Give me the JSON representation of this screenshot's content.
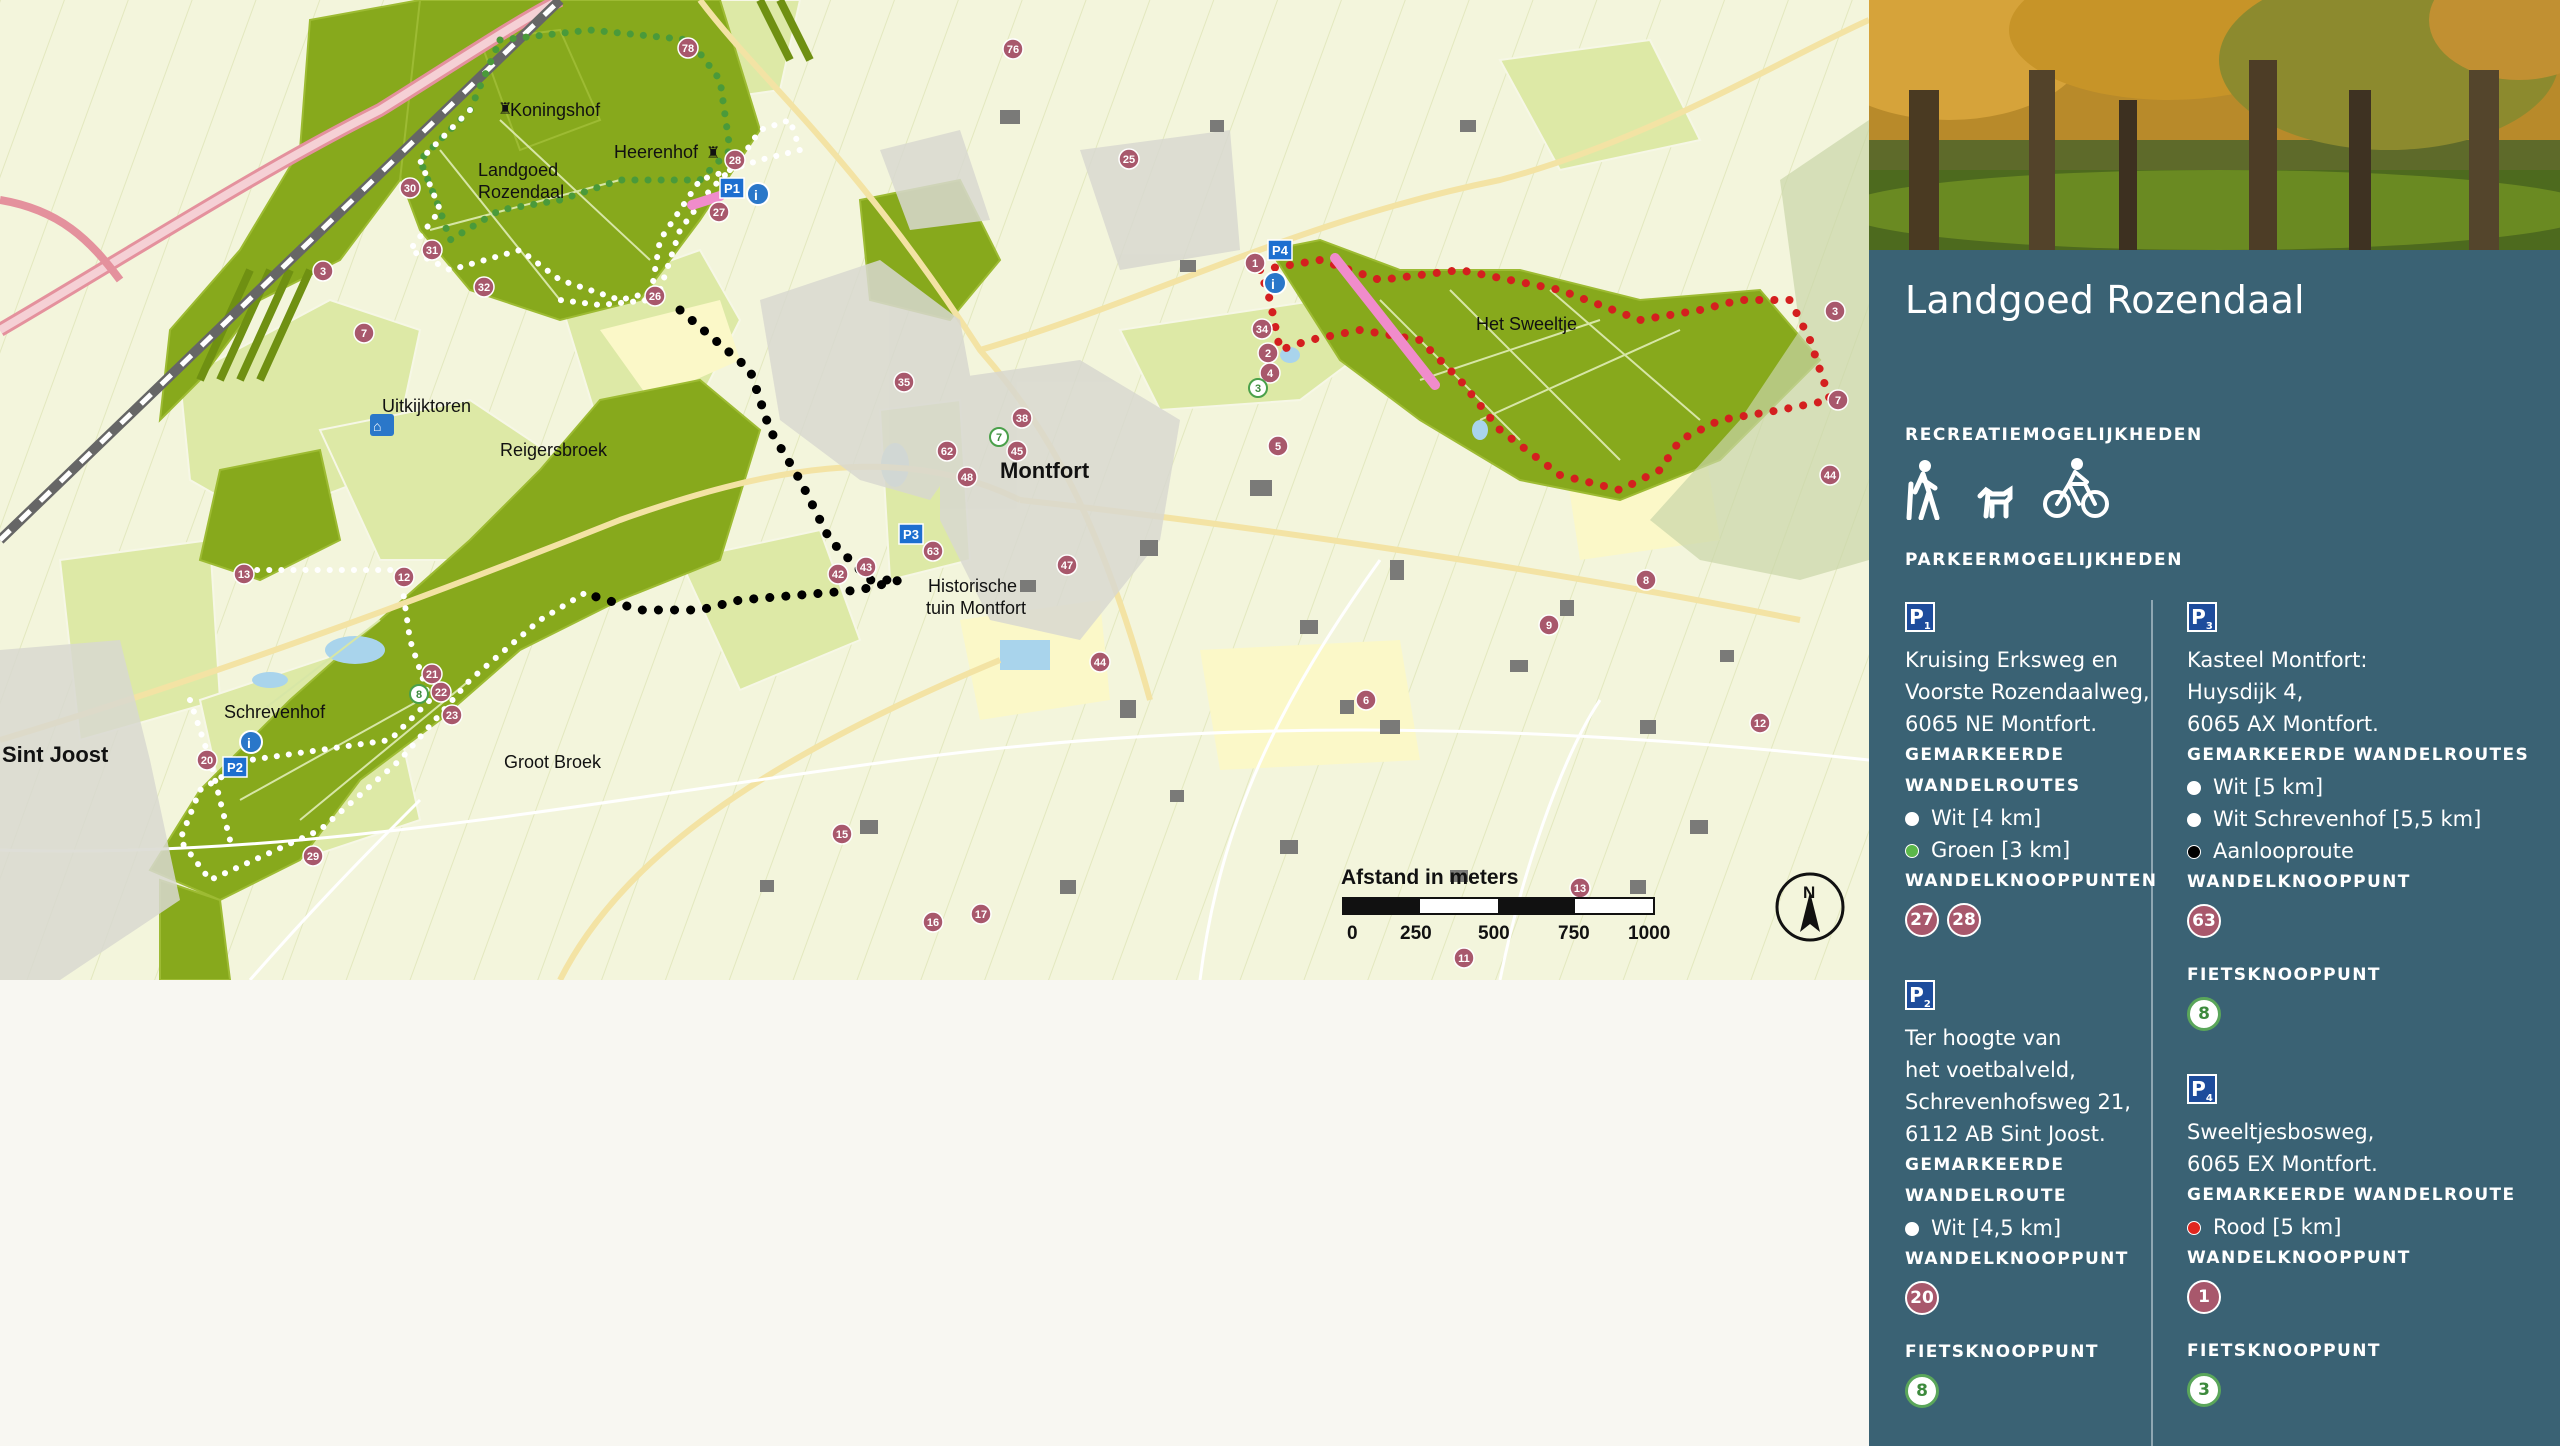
{
  "map": {
    "place_labels": {
      "koningshof": "Koningshof",
      "landgoed_rozendaal": [
        "Landgoed",
        "Rozendaal"
      ],
      "heerenhof": "Heerenhof",
      "uitkijktoren": "Uitkijktoren",
      "reigersbroek": "Reigersbroek",
      "montfort": "Montfort",
      "historische_tuin": [
        "Historische",
        "tuin Montfort"
      ],
      "het_sweeltje": "Het Sweeltje",
      "schrevenhof": "Schrevenhof",
      "sint_joost": "Sint Joost",
      "groot_broek": "Groot Broek"
    },
    "parking_labels": [
      "P1",
      "P2",
      "P3",
      "P4"
    ],
    "knooppunten": [
      "78",
      "30",
      "31",
      "32",
      "3",
      "7",
      "28",
      "27",
      "26",
      "25",
      "76",
      "35",
      "38",
      "45",
      "48",
      "62",
      "63",
      "42",
      "43",
      "47",
      "44",
      "34",
      "1",
      "2",
      "4",
      "5",
      "3",
      "7",
      "44",
      "8",
      "9",
      "6",
      "12",
      "13",
      "12",
      "21",
      "22",
      "23",
      "20",
      "29",
      "15",
      "16",
      "17",
      "11",
      "13",
      "44"
    ],
    "fiets_knooppunten": [
      "8",
      "7",
      "3"
    ],
    "scale": {
      "title": "Afstand in meters",
      "ticks": [
        "0",
        "250",
        "500",
        "750",
        "1000"
      ]
    },
    "north": "N",
    "colors": {
      "forest": "#86a81b",
      "light_green": "#dbeaa3",
      "field": "#f2f4d9",
      "knoop": "#a8586c",
      "route_red": "#d41f1f",
      "route_black": "#000000"
    }
  },
  "panel": {
    "title": "Landgoed Rozendaal",
    "recreatie_heading": "RECREATIEMOGELIJKHEDEN",
    "recreatie_icons": [
      "hiker-icon",
      "dog-icon",
      "cyclist-icon"
    ],
    "parkeer_heading": "PARKEERMOGELIJKHEDEN",
    "p1": {
      "badge": "P",
      "badge_sub": "1",
      "address": [
        "Kruising Erksweg en",
        "Voorste Rozendaalweg,",
        "6065 NE Montfort."
      ],
      "routes_heading": [
        "GEMARKEERDE",
        "WANDELROUTES"
      ],
      "routes": [
        {
          "label": "Wit [4 km]",
          "color": "#ffffff"
        },
        {
          "label": "Groen [3 km]",
          "color": "#5cb84a"
        }
      ],
      "knoop_heading": "WANDELKNOOPPUNTEN",
      "knoop": [
        "27",
        "28"
      ]
    },
    "p2": {
      "badge": "P",
      "badge_sub": "2",
      "address": [
        "Ter hoogte van",
        "het voetbalveld,",
        "Schrevenhofsweg 21,",
        "6112 AB Sint Joost."
      ],
      "routes_heading": [
        "GEMARKEERDE",
        "WANDELROUTE"
      ],
      "routes": [
        {
          "label": "Wit [4,5 km]",
          "color": "#ffffff"
        }
      ],
      "knoop_heading": "WANDELKNOOPPUNT",
      "knoop": [
        "20"
      ],
      "fiets_heading": "FIETSKNOOPPUNT",
      "fiets": "8"
    },
    "p3": {
      "badge": "P",
      "badge_sub": "3",
      "address": [
        "Kasteel Montfort:",
        "Huysdijk 4,",
        "6065 AX Montfort."
      ],
      "routes_heading": [
        "GEMARKEERDE WANDELROUTES"
      ],
      "routes": [
        {
          "label": "Wit [5 km]",
          "color": "#ffffff"
        },
        {
          "label": "Wit Schrevenhof [5,5 km]",
          "color": "#ffffff"
        },
        {
          "label": "Aanlooproute",
          "color": "#000000"
        }
      ],
      "knoop_heading": "WANDELKNOOPPUNT",
      "knoop": [
        "63"
      ],
      "fiets_heading": "FIETSKNOOPPUNT",
      "fiets": "8"
    },
    "p4": {
      "badge": "P",
      "badge_sub": "4",
      "address": [
        "Sweeltjesbosweg,",
        "6065 EX Montfort."
      ],
      "routes_heading": [
        "GEMARKEERDE WANDELROUTE"
      ],
      "routes": [
        {
          "label": "Rood [5 km]",
          "color": "#e0261f"
        }
      ],
      "knoop_heading": "WANDELKNOOPPUNT",
      "knoop": [
        "1"
      ],
      "fiets_heading": "FIETSKNOOPPUNT",
      "fiets": "3"
    }
  }
}
